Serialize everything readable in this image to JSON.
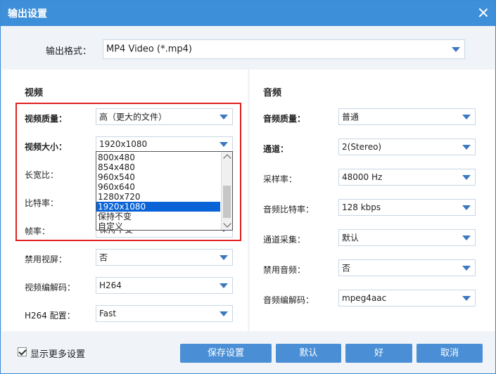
{
  "window": {
    "title": "输出设置"
  },
  "output_format": {
    "label": "输出格式：",
    "value": "MP4 Video (*.mp4)"
  },
  "video": {
    "heading": "视频",
    "quality": {
      "label": "视频质量：",
      "value": "高（更大的文件）"
    },
    "size": {
      "label": "视频大小：",
      "value": "1920x1080",
      "options": [
        "800x480",
        "854x480",
        "960x540",
        "960x640",
        "1280x720",
        "1920x1080",
        "保持不变",
        "自定义"
      ],
      "selected_index": 5
    },
    "aspect": {
      "label": "长宽比："
    },
    "bitrate": {
      "label": "比特率："
    },
    "framerate": {
      "label": "帧率：",
      "value": "保持不变"
    },
    "disable_video": {
      "label": "禁用视屏：",
      "value": "否"
    },
    "codec": {
      "label": "视频编解码：",
      "value": "H264"
    },
    "h264_profile": {
      "label": "H264 配置：",
      "value": "Fast"
    }
  },
  "audio": {
    "heading": "音频",
    "quality": {
      "label": "音频质量：",
      "value": "普通"
    },
    "channels": {
      "label": "通道：",
      "value": "2(Stereo)"
    },
    "sample_rate": {
      "label": "采样率：",
      "value": "48000 Hz"
    },
    "bitrate": {
      "label": "音频比特率：",
      "value": "128 kbps"
    },
    "capture": {
      "label": "通道采集：",
      "value": "默认"
    },
    "disable_audio": {
      "label": "禁用音频：",
      "value": "否"
    },
    "codec": {
      "label": "音频编解码：",
      "value": "mpeg4aac"
    }
  },
  "footer": {
    "show_more_label": "显示更多设置",
    "show_more_checked": true,
    "save_label": "保存设置",
    "default_label": "默认",
    "ok_label": "好",
    "cancel_label": "取消"
  },
  "colors": {
    "accent": "#3e8fd9",
    "highlight_border": "#e02020",
    "selection": "#0a64d8"
  }
}
